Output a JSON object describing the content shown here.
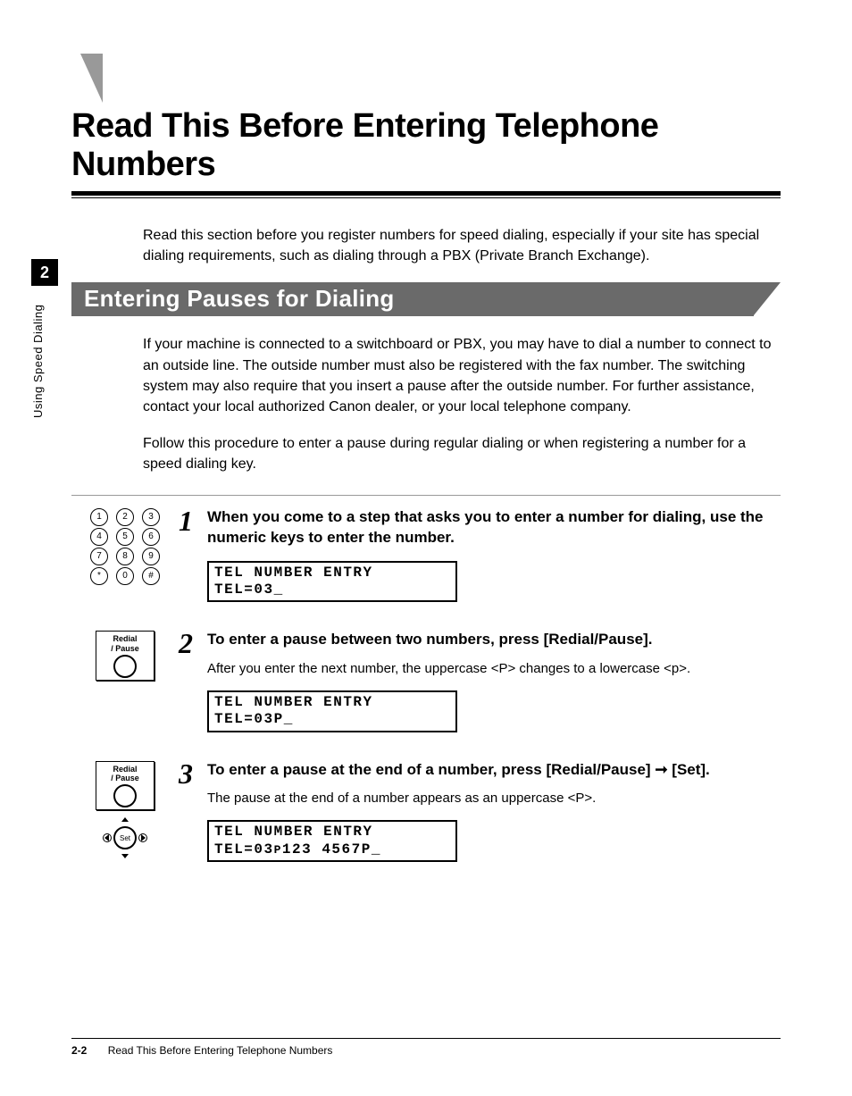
{
  "side_tab": {
    "num": "2",
    "label": "Using Speed Dialing"
  },
  "main_title": "Read This Before Entering Telephone Numbers",
  "intro": "Read this section before you register numbers for speed dialing, especially if your site has special dialing requirements, such as dialing through a PBX (Private Branch Exchange).",
  "subheader": "Entering Pauses for Dialing",
  "para1": "If your machine is connected to a switchboard or PBX, you may have to dial a number to connect to an outside line. The outside number must also be registered with the fax number. The switching system may also require that you insert a pause after the outside number. For further assistance, contact your local authorized Canon dealer, or your local telephone company.",
  "para2": "Follow this procedure to enter a pause during regular dialing or when registering a number for a speed dialing key.",
  "keypad": [
    [
      "1",
      "2",
      "3"
    ],
    [
      "4",
      "5",
      "6"
    ],
    [
      "7",
      "8",
      "9"
    ],
    [
      "*",
      "0",
      "#"
    ]
  ],
  "redial_label_line1": "Redial",
  "redial_label_line2": "/ Pause",
  "set_label": "Set",
  "steps": [
    {
      "num": "1",
      "title": "When you come to a step that asks you to enter a number for dialing, use the numeric keys to enter the number.",
      "sub": "",
      "lcd": "TEL NUMBER ENTRY\nTEL=03_"
    },
    {
      "num": "2",
      "title": "To enter a pause between two numbers, press [Redial/Pause].",
      "sub": "After you enter the next number, the uppercase <P> changes to a lowercase <p>.",
      "lcd": "TEL NUMBER ENTRY\nTEL=03P_"
    },
    {
      "num": "3",
      "title": "To enter a pause at the end of a number, press [Redial/Pause] ➞ [Set].",
      "sub": "The pause at the end of a number appears as an uppercase <P>.",
      "lcd": "TEL NUMBER ENTRY\nTEL=03p123 4567P_"
    }
  ],
  "footer": {
    "page": "2-2",
    "title": "Read This Before Entering Telephone Numbers"
  }
}
